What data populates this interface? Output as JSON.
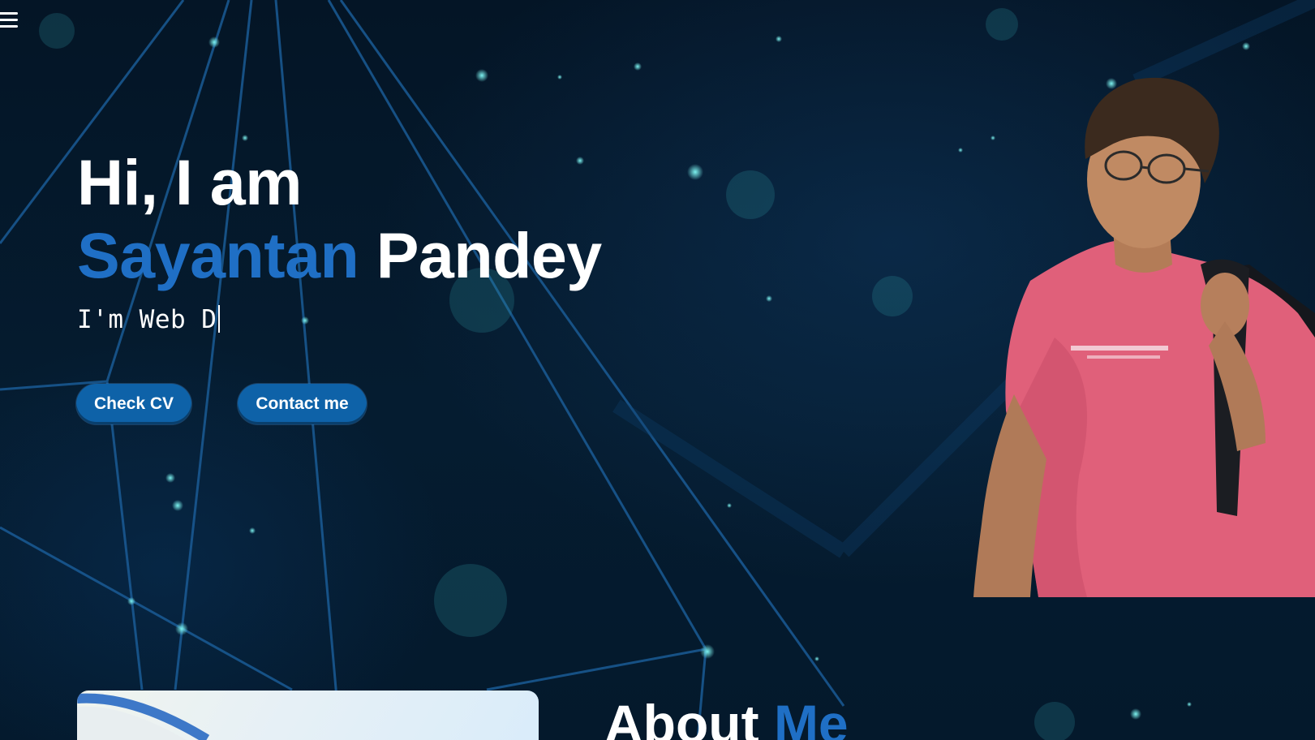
{
  "nav": {
    "menu_icon": "hamburger-menu-icon"
  },
  "hero": {
    "greeting": "Hi, I am",
    "first_name": "Sayantan",
    "last_name": "Pandey",
    "typing_text": "I'm Web D",
    "buttons": {
      "cv": "Check CV",
      "contact": "Contact me"
    }
  },
  "about": {
    "title_part1": "About",
    "title_part2": "Me"
  },
  "colors": {
    "background": "#04172a",
    "accent": "#1f6fc5",
    "button": "#0e62a8",
    "shirt": "#e0607a"
  }
}
